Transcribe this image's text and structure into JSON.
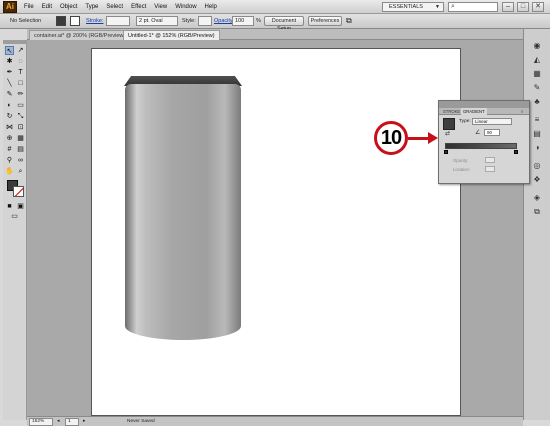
{
  "app": {
    "logo": "Ai",
    "menus": [
      "File",
      "Edit",
      "Object",
      "Type",
      "Select",
      "Effect",
      "View",
      "Window",
      "Help"
    ],
    "workspace": "ESSENTIALS",
    "window_buttons": [
      "–",
      "□",
      "✕"
    ]
  },
  "control_bar": {
    "selection": "No Selection",
    "stroke_label": "Stroke:",
    "brush": "2 pt. Oval",
    "style_label": "Style:",
    "opacity_label": "Opacity:",
    "opacity": "100",
    "opacity_unit": "%",
    "document_setup": "Document Setup",
    "preferences": "Preferences"
  },
  "tabs": [
    {
      "label": "container.ai* @ 200% (RGB/Preview)",
      "active": false
    },
    {
      "label": "Untitled-1* @ 152% (RGB/Preview)",
      "active": true
    }
  ],
  "gradient_panel": {
    "tabs": [
      "STROKE",
      "GRADIENT"
    ],
    "type_label": "Type:",
    "type": "Linear",
    "angle": "90",
    "opacity_label": "Opacity:",
    "location_label": "Location:"
  },
  "callout": "10",
  "status_bar": {
    "zoom": "152%",
    "page": "1",
    "save_state": "Never Saved"
  },
  "colors": {
    "fill": "#3b3b3b",
    "callout_red": "#c8101a",
    "artboard": "#ffffff"
  }
}
